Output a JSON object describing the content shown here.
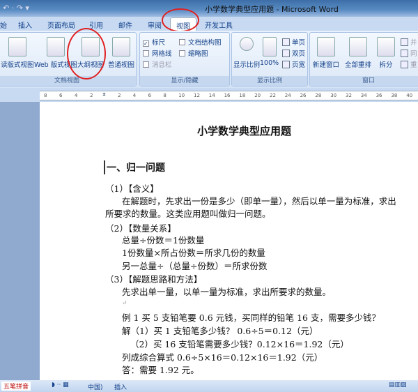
{
  "window": {
    "title": "小学数学典型应用题 - Microsoft Word",
    "qat": "↶ · ↷  ▾"
  },
  "tabs": [
    "始",
    "插入",
    "页面布局",
    "引用",
    "邮件",
    "审阅",
    "视图",
    "开发工具"
  ],
  "active_tab": "视图",
  "ribbon": {
    "doc_views": {
      "label": "文档视图",
      "buttons": [
        "读版式视图",
        "Web 版式视图",
        "大纲视图",
        "普通视图"
      ]
    },
    "show_hide": {
      "label": "显示/隐藏",
      "checks": [
        {
          "label": "标尺",
          "checked": true
        },
        {
          "label": "文档结构图",
          "checked": false
        },
        {
          "label": "网格线",
          "checked": false
        },
        {
          "label": "缩略图",
          "checked": false
        },
        {
          "label": "消息栏",
          "checked": false,
          "disabled": true
        }
      ]
    },
    "zoom": {
      "label": "显示比例",
      "buttons": [
        "显示比例",
        "100%"
      ],
      "small": [
        "单页",
        "双页",
        "页宽"
      ]
    },
    "window": {
      "label": "窗口",
      "buttons": [
        "新建窗口",
        "全部重排",
        "拆分"
      ],
      "small": [
        "并",
        "同",
        "重"
      ]
    }
  },
  "ruler": {
    "left": [
      "8",
      "6",
      "4",
      "2"
    ],
    "right": [
      "2",
      "4",
      "6",
      "8",
      "10",
      "12",
      "14",
      "16",
      "18",
      "20",
      "22",
      "24",
      "26",
      "28",
      "30",
      "32",
      "34",
      "36",
      "38",
      "40"
    ]
  },
  "doc": {
    "title": "小学数学典型应用题",
    "heading": "一、归一问题",
    "lines": [
      "（1）【含义】",
      "在解题时，先求出一份是多少（即单一量），然后以单一量为标准，求出",
      "所要求的数量。这类应用题叫做归一问题。",
      "（2）【数量关系】",
      "总量÷份数＝1份数量",
      "1份数量×所占份数＝所求几份的数量",
      "另一总量÷（总量÷份数）＝所求份数",
      "（3）【解题思路和方法】",
      "先求出单一量，以单一量为标准，求出所要求的数量。",
      "",
      "例 1 买 5 支铅笔要 0.6 元钱，买同样的铅笔 16 支，需要多少钱？",
      "解（1）买 1 支铅笔多少钱？ 0.6÷5＝0.12（元）",
      "（2）买 16 支铅笔需要多少钱？0.12×16＝1.92（元）",
      "列成综合算式 0.6÷5×16＝0.12×16＝1.92（元）",
      "答：需要 1.92 元。"
    ]
  },
  "status": {
    "ime": "五笔拼音",
    "lang": "中国)",
    "mode": "插入"
  }
}
